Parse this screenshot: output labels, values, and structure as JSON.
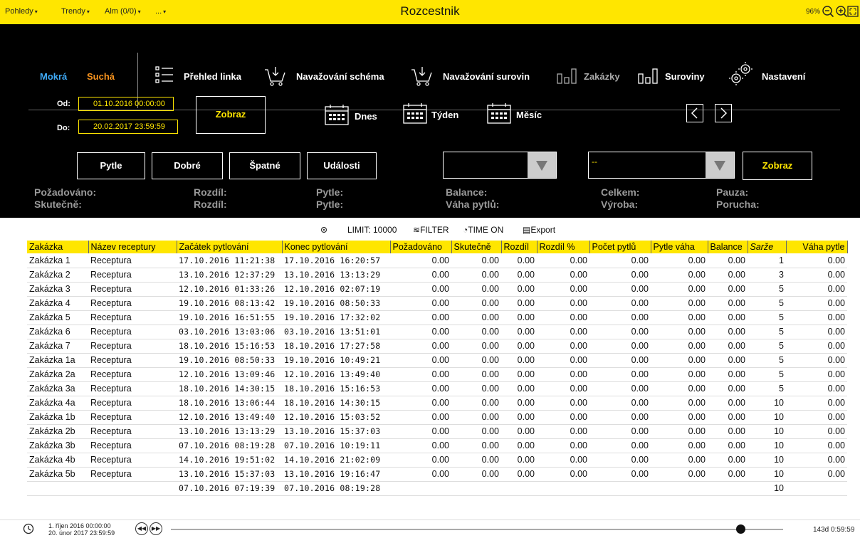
{
  "topbar": {
    "menus": [
      "Pohledy",
      "Trendy",
      "Alm (0/0)",
      "..."
    ],
    "title": "Rozcestnik",
    "zoom": "96%",
    "accent": "#ffe600"
  },
  "nav": {
    "mokra": "Mokrá",
    "sucha": "Suchá",
    "items": [
      "Přehled linka",
      "Navažování schéma",
      "Navažování surovin",
      "Zakázky",
      "Suroviny",
      "Nastavení"
    ],
    "icons": [
      "list-icon",
      "cart-icon",
      "cart-icon",
      "bars-icon",
      "bars-icon",
      "gears-icon"
    ]
  },
  "filter": {
    "od_label": "Od:",
    "do_label": "Do:",
    "od_value": "01.10.2016 00:00:00",
    "do_value": "20.02.2017 23:59:59",
    "zobraz": "Zobraz",
    "dnes": "Dnes",
    "tyden": "Týden",
    "mesic": "Měsíc"
  },
  "buttons": {
    "pytle": "Pytle",
    "dobre": "Dobré",
    "spatne": "Špatné",
    "udalosti": "Události",
    "select2_value": "--",
    "zobraz2": "Zobraz"
  },
  "stats": {
    "pozadovano": "Požadováno:",
    "skutecne": "Skutečně:",
    "rozdil1": "Rozdíl:",
    "rozdil2": "Rozdíl:",
    "pytle1": "Pytle:",
    "pytle2": "Pytle:",
    "balance": "Balance:",
    "vaha": "Váha pytlů:",
    "celkem": "Celkem:",
    "vyroba": "Výroba:",
    "pauza": "Pauza:",
    "porucha": "Porucha:"
  },
  "toolbar": {
    "limit": "LIMIT: 10000",
    "filter": "FILTER",
    "time_on": "TIME ON",
    "export": "Export"
  },
  "table": {
    "columns": [
      "Zakázka",
      "Název receptury",
      "Začátek pytlování",
      "Konec pytlování",
      "Požadováno",
      "Skutečně",
      "Rozdíl",
      "Rozdíl %",
      "Počet pytlů",
      "Pytle váha",
      "Balance",
      "Sarže",
      "Váha pytle"
    ],
    "rows": [
      [
        "Zakázka 1",
        "Receptura",
        "17.10.2016 11:21:38",
        "17.10.2016 16:20:57",
        "0.00",
        "0.00",
        "0.00",
        "0.00",
        "0.00",
        "0.00",
        "0.00",
        "1",
        "0.00"
      ],
      [
        "Zakázka 2",
        "Receptura",
        "13.10.2016 12:37:29",
        "13.10.2016 13:13:29",
        "0.00",
        "0.00",
        "0.00",
        "0.00",
        "0.00",
        "0.00",
        "0.00",
        "3",
        "0.00"
      ],
      [
        "Zakázka 3",
        "Receptura",
        "12.10.2016 01:33:26",
        "12.10.2016 02:07:19",
        "0.00",
        "0.00",
        "0.00",
        "0.00",
        "0.00",
        "0.00",
        "0.00",
        "5",
        "0.00"
      ],
      [
        "Zakázka 4",
        "Receptura",
        "19.10.2016 08:13:42",
        "19.10.2016 08:50:33",
        "0.00",
        "0.00",
        "0.00",
        "0.00",
        "0.00",
        "0.00",
        "0.00",
        "5",
        "0.00"
      ],
      [
        "Zakázka 5",
        "Receptura",
        "19.10.2016 16:51:55",
        "19.10.2016 17:32:02",
        "0.00",
        "0.00",
        "0.00",
        "0.00",
        "0.00",
        "0.00",
        "0.00",
        "5",
        "0.00"
      ],
      [
        "Zakázka 6",
        "Receptura",
        "03.10.2016 13:03:06",
        "03.10.2016 13:51:01",
        "0.00",
        "0.00",
        "0.00",
        "0.00",
        "0.00",
        "0.00",
        "0.00",
        "5",
        "0.00"
      ],
      [
        "Zakázka 7",
        "Receptura",
        "18.10.2016 15:16:53",
        "18.10.2016 17:27:58",
        "0.00",
        "0.00",
        "0.00",
        "0.00",
        "0.00",
        "0.00",
        "0.00",
        "5",
        "0.00"
      ],
      [
        "Zakázka 1a",
        "Receptura",
        "19.10.2016 08:50:33",
        "19.10.2016 10:49:21",
        "0.00",
        "0.00",
        "0.00",
        "0.00",
        "0.00",
        "0.00",
        "0.00",
        "5",
        "0.00"
      ],
      [
        "Zakázka 2a",
        "Receptura",
        "12.10.2016 13:09:46",
        "12.10.2016 13:49:40",
        "0.00",
        "0.00",
        "0.00",
        "0.00",
        "0.00",
        "0.00",
        "0.00",
        "5",
        "0.00"
      ],
      [
        "Zakázka 3a",
        "Receptura",
        "18.10.2016 14:30:15",
        "18.10.2016 15:16:53",
        "0.00",
        "0.00",
        "0.00",
        "0.00",
        "0.00",
        "0.00",
        "0.00",
        "5",
        "0.00"
      ],
      [
        "Zakázka 4a",
        "Receptura",
        "18.10.2016 13:06:44",
        "18.10.2016 14:30:15",
        "0.00",
        "0.00",
        "0.00",
        "0.00",
        "0.00",
        "0.00",
        "0.00",
        "10",
        "0.00"
      ],
      [
        "Zakázka 1b",
        "Receptura",
        "12.10.2016 13:49:40",
        "12.10.2016 15:03:52",
        "0.00",
        "0.00",
        "0.00",
        "0.00",
        "0.00",
        "0.00",
        "0.00",
        "10",
        "0.00"
      ],
      [
        "Zakázka 2b",
        "Receptura",
        "13.10.2016 13:13:29",
        "13.10.2016 15:37:03",
        "0.00",
        "0.00",
        "0.00",
        "0.00",
        "0.00",
        "0.00",
        "0.00",
        "10",
        "0.00"
      ],
      [
        "Zakázka 3b",
        "Receptura",
        "07.10.2016 08:19:28",
        "07.10.2016 10:19:11",
        "0.00",
        "0.00",
        "0.00",
        "0.00",
        "0.00",
        "0.00",
        "0.00",
        "10",
        "0.00"
      ],
      [
        "Zakázka 4b",
        "Receptura",
        "14.10.2016 19:51:02",
        "14.10.2016 21:02:09",
        "0.00",
        "0.00",
        "0.00",
        "0.00",
        "0.00",
        "0.00",
        "0.00",
        "10",
        "0.00"
      ],
      [
        "Zakázka 5b",
        "Receptura",
        "13.10.2016 15:37:03",
        "13.10.2016 19:16:47",
        "0.00",
        "0.00",
        "0.00",
        "0.00",
        "0.00",
        "0.00",
        "0.00",
        "10",
        "0.00"
      ],
      [
        "",
        "",
        "07.10.2016 07:19:39",
        "07.10.2016 08:19:28",
        "",
        "",
        "",
        "",
        "",
        "",
        "",
        "10",
        ""
      ]
    ]
  },
  "timeline": {
    "start": "1. říjen 2016 00:00:00",
    "end": "20. únor 2017 23:59:59",
    "duration": "143d 0:59:59",
    "position_fraction": 0.93
  }
}
